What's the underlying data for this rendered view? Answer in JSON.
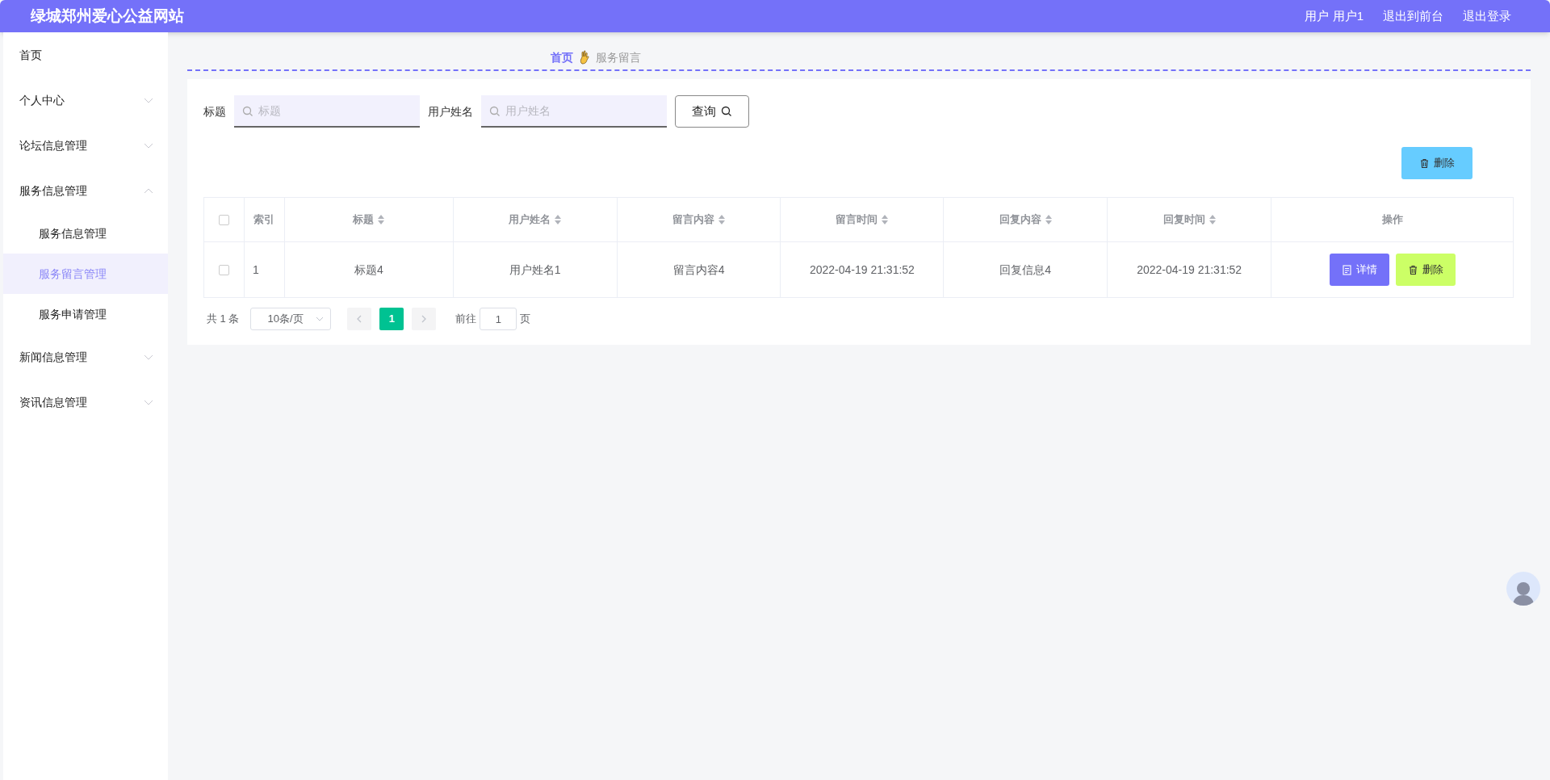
{
  "header": {
    "title": "绿城郑州爱心公益网站",
    "user": "用户 用户1",
    "links": [
      "退出到前台",
      "退出登录"
    ]
  },
  "sidebar": {
    "items": [
      {
        "label": "首页",
        "selected": false
      },
      {
        "label": "个人中心",
        "expanded": false,
        "selected": false
      },
      {
        "label": "论坛信息管理",
        "expanded": false,
        "selected": false
      },
      {
        "label": "服务信息管理",
        "expanded": true,
        "selected": false,
        "children": [
          {
            "label": "服务信息管理",
            "selected": false
          },
          {
            "label": "服务留言管理",
            "selected": true
          },
          {
            "label": "服务申请管理",
            "selected": false
          }
        ]
      },
      {
        "label": "新闻信息管理",
        "expanded": false,
        "selected": false
      },
      {
        "label": "资讯信息管理",
        "expanded": false,
        "selected": false
      }
    ]
  },
  "breadcrumb": [
    "首页",
    "服务留言"
  ],
  "search": {
    "fields": [
      {
        "label": "标题",
        "placeholder": "标题"
      },
      {
        "label": "用户姓名",
        "placeholder": "用户姓名"
      }
    ],
    "button": "查询"
  },
  "toolbar": {
    "delete_button": "删除"
  },
  "table": {
    "columns": [
      {
        "label": "索引",
        "sortable": false
      },
      {
        "label": "标题",
        "sortable": true
      },
      {
        "label": "用户姓名",
        "sortable": true
      },
      {
        "label": "留言内容",
        "sortable": true
      },
      {
        "label": "留言时间",
        "sortable": true
      },
      {
        "label": "回复内容",
        "sortable": true
      },
      {
        "label": "回复时间",
        "sortable": true
      },
      {
        "label": "操作",
        "sortable": false
      }
    ],
    "header_checked": false,
    "rows": [
      {
        "checked": false,
        "cells": [
          "1",
          "标题4",
          "用户姓名1",
          "留言内容4",
          "2022-04-19 21:31:52",
          "回复信息4",
          "2022-04-19 21:31:52"
        ],
        "actions": [
          "详情",
          "删除"
        ]
      }
    ]
  },
  "pagination": {
    "total": "共 1 条",
    "page_size": "10条/页",
    "pages": [
      {
        "label": "1",
        "selected": true
      }
    ],
    "goto_label": "前往",
    "goto_value": "1",
    "goto_suffix": "页"
  }
}
